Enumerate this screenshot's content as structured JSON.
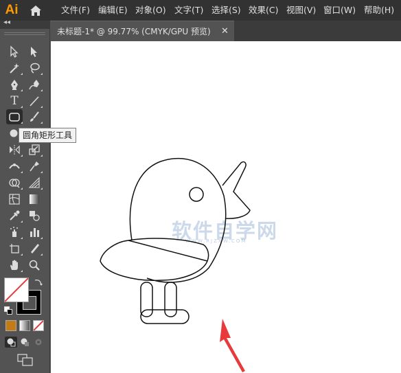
{
  "app": {
    "logo_text": "Ai",
    "logo_color": "#ff9a00"
  },
  "menu": {
    "items": [
      "文件(F)",
      "编辑(E)",
      "对象(O)",
      "文字(T)",
      "选择(S)",
      "效果(C)",
      "视图(V)",
      "窗口(W)",
      "帮助(H)"
    ]
  },
  "document": {
    "tab_title": "未标题-1* @ 99.77% (CMYK/GPU 预览)",
    "close_glyph": "✕"
  },
  "toolbar": {
    "collapse_glyph": "◂◂",
    "tooltip": "圆角矩形工具",
    "type_tool_glyph": "T",
    "selected_tool": "rounded-rectangle-tool",
    "tools": [
      "selection-tool",
      "direct-selection-tool",
      "magic-wand-tool",
      "lasso-tool",
      "pen-tool",
      "curvature-tool",
      "type-tool",
      "line-segment-tool",
      "rounded-rectangle-tool",
      "paintbrush-tool",
      "shaper-tool",
      "eraser-tool",
      "rotate-tool",
      "scale-tool",
      "width-tool",
      "puppet-warp-tool",
      "shape-builder-tool",
      "perspective-grid-tool",
      "mesh-tool",
      "gradient-tool",
      "eyedropper-tool",
      "blend-tool",
      "symbol-sprayer-tool",
      "column-graph-tool",
      "artboard-tool",
      "slice-tool",
      "hand-tool",
      "zoom-tool"
    ],
    "fill_color": "#ffffff",
    "stroke_color": "#000000",
    "color_mode_colors": [
      "#c47b15",
      "#9a9a9a",
      "#ffffff"
    ]
  },
  "canvas": {
    "background": "#ffffff",
    "watermark_main": "软件自学网",
    "watermark_sub": "WWW.RJZXW.COM",
    "arrow_color": "#e8393b"
  }
}
